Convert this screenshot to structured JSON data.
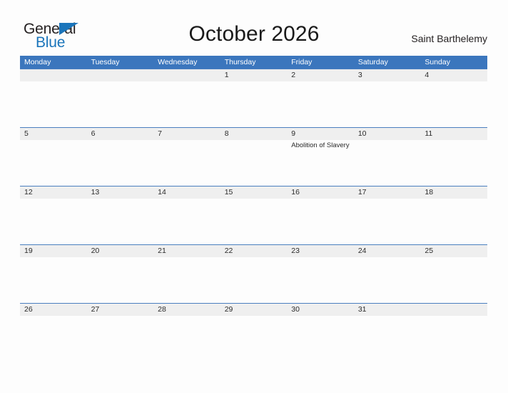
{
  "brand": {
    "name_part1": "General",
    "name_part2": "Blue",
    "flag_icon": "triangle-flag-icon",
    "accent_color": "#1b75bb"
  },
  "header": {
    "title": "October 2026",
    "region": "Saint Barthelemy"
  },
  "calendar": {
    "month": "October",
    "year": "2026",
    "header_color": "#3b76bd",
    "band_color": "#efefef",
    "weekdays": [
      "Monday",
      "Tuesday",
      "Wednesday",
      "Thursday",
      "Friday",
      "Saturday",
      "Sunday"
    ],
    "weeks": [
      {
        "days": [
          {
            "num": "",
            "event": ""
          },
          {
            "num": "",
            "event": ""
          },
          {
            "num": "",
            "event": ""
          },
          {
            "num": "1",
            "event": ""
          },
          {
            "num": "2",
            "event": ""
          },
          {
            "num": "3",
            "event": ""
          },
          {
            "num": "4",
            "event": ""
          }
        ]
      },
      {
        "days": [
          {
            "num": "5",
            "event": ""
          },
          {
            "num": "6",
            "event": ""
          },
          {
            "num": "7",
            "event": ""
          },
          {
            "num": "8",
            "event": ""
          },
          {
            "num": "9",
            "event": "Abolition of Slavery"
          },
          {
            "num": "10",
            "event": ""
          },
          {
            "num": "11",
            "event": ""
          }
        ]
      },
      {
        "days": [
          {
            "num": "12",
            "event": ""
          },
          {
            "num": "13",
            "event": ""
          },
          {
            "num": "14",
            "event": ""
          },
          {
            "num": "15",
            "event": ""
          },
          {
            "num": "16",
            "event": ""
          },
          {
            "num": "17",
            "event": ""
          },
          {
            "num": "18",
            "event": ""
          }
        ]
      },
      {
        "days": [
          {
            "num": "19",
            "event": ""
          },
          {
            "num": "20",
            "event": ""
          },
          {
            "num": "21",
            "event": ""
          },
          {
            "num": "22",
            "event": ""
          },
          {
            "num": "23",
            "event": ""
          },
          {
            "num": "24",
            "event": ""
          },
          {
            "num": "25",
            "event": ""
          }
        ]
      },
      {
        "days": [
          {
            "num": "26",
            "event": ""
          },
          {
            "num": "27",
            "event": ""
          },
          {
            "num": "28",
            "event": ""
          },
          {
            "num": "29",
            "event": ""
          },
          {
            "num": "30",
            "event": ""
          },
          {
            "num": "31",
            "event": ""
          },
          {
            "num": "",
            "event": ""
          }
        ]
      }
    ]
  }
}
